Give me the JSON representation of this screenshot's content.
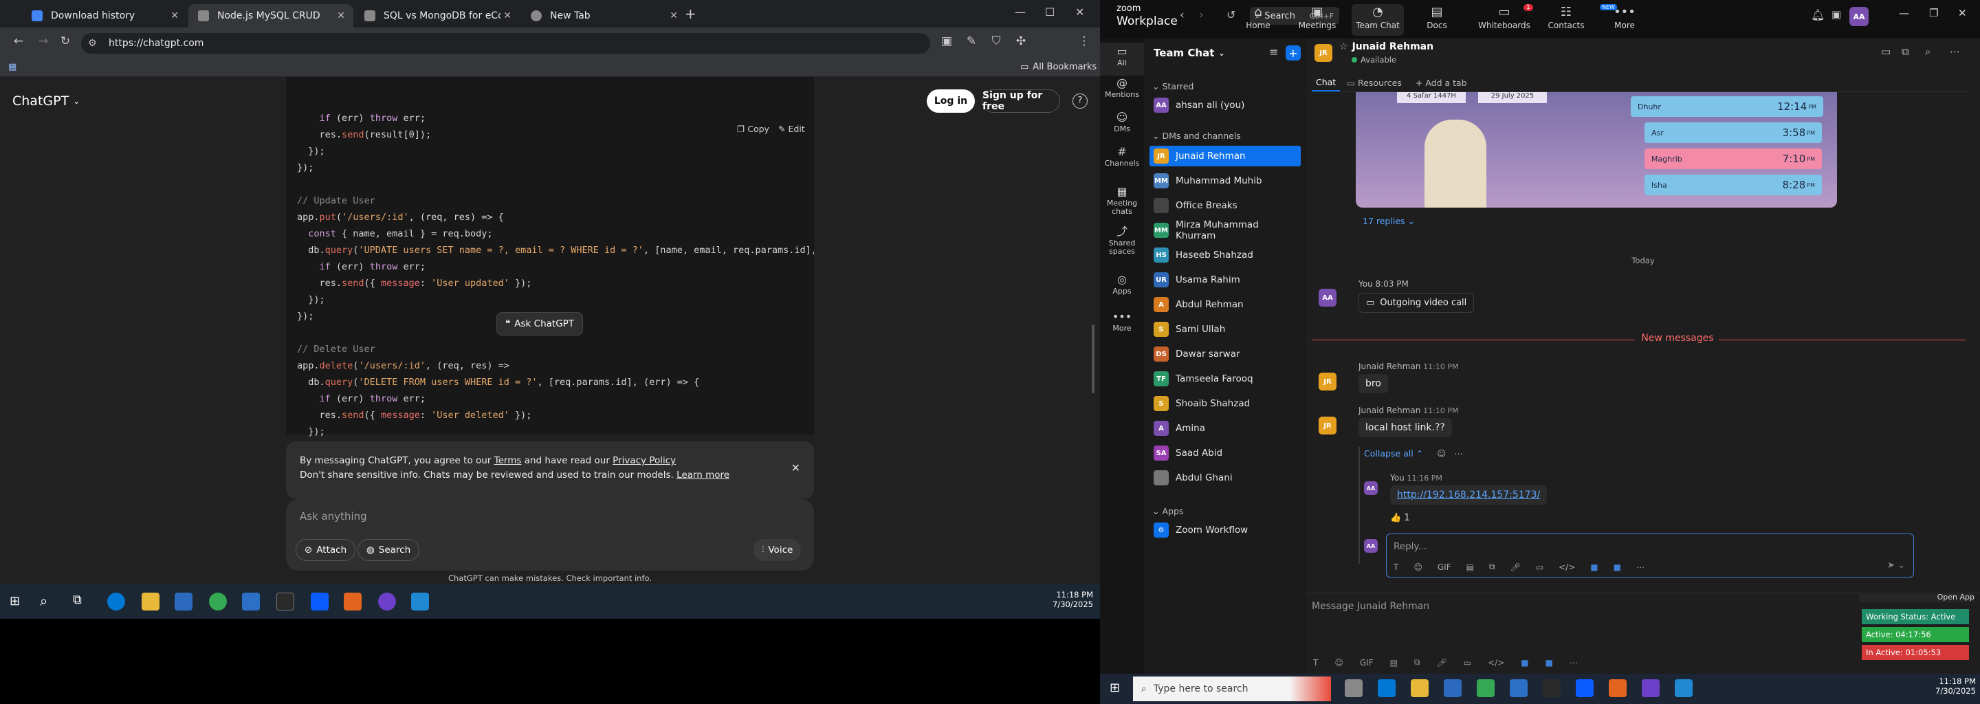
{
  "browser": {
    "tabs": [
      {
        "label": "Download history",
        "color": "#4285f4"
      },
      {
        "label": "Node.js MySQL CRUD",
        "color": "#888888"
      },
      {
        "label": "SQL vs MongoDB for eCommerce",
        "color": "#888888"
      },
      {
        "label": "New Tab",
        "color": "#888888"
      }
    ],
    "new_tab": "+",
    "url": "https://chatgpt.com",
    "all_bookmarks": "All Bookmarks",
    "window_controls": [
      "—",
      "☐",
      "✕"
    ]
  },
  "chatgpt": {
    "brand": "ChatGPT",
    "login": "Log in",
    "signup": "Sign up for free",
    "help": "?",
    "copy": "Copy",
    "edit": "Edit",
    "ask_popup": "Ask ChatGPT",
    "code_lines": [
      "    if (err) throw err;",
      "    res.send(result[0]);",
      "  });",
      "});",
      "",
      "// Update User",
      "app.put('/users/:id', (req, res) => {",
      "  const { name, email } = req.body;",
      "  db.query('UPDATE users SET name = ?, email = ? WHERE id = ?', [name, email, req.params.id], (err",
      "    if (err) throw err;",
      "    res.send({ message: 'User updated' });",
      "  });",
      "});",
      "",
      "// Delete User",
      "app.delete('/users/:id', (req, res) =>",
      "  db.query('DELETE FROM users WHERE id = ?', [req.params.id], (err) => {",
      "    if (err) throw err;",
      "    res.send({ message: 'User deleted' });",
      "  });",
      "});"
    ],
    "notice_line1_a": "By messaging ChatGPT, you agree to our ",
    "notice_terms": "Terms",
    "notice_line1_b": " and have read our ",
    "notice_privacy": "Privacy Policy",
    "notice_line2": "Don't share sensitive info. Chats may be reviewed and used to train our models. ",
    "notice_learn": "Learn more",
    "input_placeholder": "Ask anything",
    "attach": "Attach",
    "search": "Search",
    "voice": "Voice",
    "disclaimer": "ChatGPT can make mistakes. Check important info."
  },
  "left_taskbar": {
    "time": "11:18 PM",
    "date": "7/30/2025"
  },
  "zoom": {
    "logo_top": "zoom",
    "logo_bottom": "Workplace",
    "search": "Search",
    "shortcut": "Ctrl+F",
    "nav": [
      {
        "label": "Home",
        "glyph": "⌂"
      },
      {
        "label": "Meetings",
        "glyph": "▣"
      },
      {
        "label": "Team Chat",
        "glyph": "◔"
      },
      {
        "label": "Docs",
        "glyph": "▤"
      },
      {
        "label": "Whiteboards",
        "glyph": "▭"
      },
      {
        "label": "Contacts",
        "glyph": "☷"
      },
      {
        "label": "More",
        "glyph": "•••"
      }
    ],
    "docs_badge": "1",
    "more_badge": "NEW",
    "user_initials": "AA",
    "rail": [
      {
        "label": "All",
        "glyph": "▭"
      },
      {
        "label": "Mentions",
        "glyph": "@"
      },
      {
        "label": "DMs",
        "glyph": "☺"
      },
      {
        "label": "Channels",
        "glyph": "#"
      },
      {
        "label": "Meeting chats",
        "glyph": "▦"
      },
      {
        "label": "Shared spaces",
        "glyph": "⤴"
      },
      {
        "label": "Apps",
        "glyph": "◎"
      },
      {
        "label": "More",
        "glyph": "•••"
      }
    ],
    "panel_title": "Team Chat",
    "starred": "Starred",
    "self": {
      "name": "ahsan ali (you)",
      "initials": "AA",
      "color": "#7a4fb0"
    },
    "dms_heading": "DMs and channels",
    "contacts": [
      {
        "name": "Junaid Rehman",
        "initials": "JR",
        "color": "#e6a020"
      },
      {
        "name": "Muhammad Muhib",
        "initials": "MM",
        "color": "#4a7fc0"
      },
      {
        "name": "Office Breaks",
        "initials": "",
        "color": "#444444"
      },
      {
        "name": "Mirza Muhammad Khurram",
        "initials": "MM",
        "color": "#2c9a68"
      },
      {
        "name": "Haseeb Shahzad",
        "initials": "HS",
        "color": "#2c8fb4"
      },
      {
        "name": "Usama Rahim",
        "initials": "UR",
        "color": "#3068b8"
      },
      {
        "name": "Abdul Rehman",
        "initials": "A",
        "color": "#d87a20"
      },
      {
        "name": "Sami Ullah",
        "initials": "S",
        "color": "#d8a020"
      },
      {
        "name": "Dawar sarwar",
        "initials": "DS",
        "color": "#c8602a"
      },
      {
        "name": "Tamseela Farooq",
        "initials": "TF",
        "color": "#2c9a68"
      },
      {
        "name": "Shoaib Shahzad",
        "initials": "S",
        "color": "#d8a020"
      },
      {
        "name": "Amina",
        "initials": "A",
        "color": "#7a4fb0"
      },
      {
        "name": "Saad Abid",
        "initials": "SA",
        "color": "#9a3fb0"
      },
      {
        "name": "Abdul Ghani",
        "initials": "",
        "color": "#777777"
      }
    ],
    "apps_heading": "Apps",
    "apps": [
      {
        "name": "Zoom Workflow"
      }
    ],
    "chat_header_name": "Junaid Rehman",
    "chat_header_status": "Available",
    "chat_tabs": [
      "Chat",
      "Resources",
      "Add a tab"
    ],
    "image_card": {
      "date1": "4 Safar 1447H",
      "date2": "29 July 2025",
      "prayers": [
        {
          "name": "Dhuhr",
          "time": "12:14",
          "suffix": "PM"
        },
        {
          "name": "Asr",
          "time": "3:58",
          "suffix": "PM"
        },
        {
          "name": "Maghrib",
          "time": "7:10",
          "suffix": "PM"
        },
        {
          "name": "Isha",
          "time": "8:28",
          "suffix": "PM"
        }
      ]
    },
    "replies": "17 replies",
    "today": "Today",
    "call_meta": "You 8:03 PM",
    "call_label": "Outgoing video call",
    "new_messages": "New messages",
    "msg1": {
      "author": "Junaid Rehman",
      "time": "11:10 PM",
      "text": "bro"
    },
    "msg2": {
      "author": "Junaid Rehman",
      "time": "11:10 PM",
      "text": "local host link.??"
    },
    "collapse": "Collapse all",
    "reply": {
      "author": "You",
      "time": "11:16 PM",
      "link": "http://192.168.214.157:5173/",
      "reaction": "👍 1"
    },
    "reply_placeholder": "Reply...",
    "composer_placeholder": "Message Junaid Rehman",
    "open_app": "Open App",
    "status_working": "Working Status: Active",
    "status_active": "Active: 04:17:56",
    "status_inactive": "In Active: 01:05:53"
  },
  "right_taskbar": {
    "search": "Type here to search",
    "time": "11:18 PM",
    "date": "7/30/2025"
  }
}
